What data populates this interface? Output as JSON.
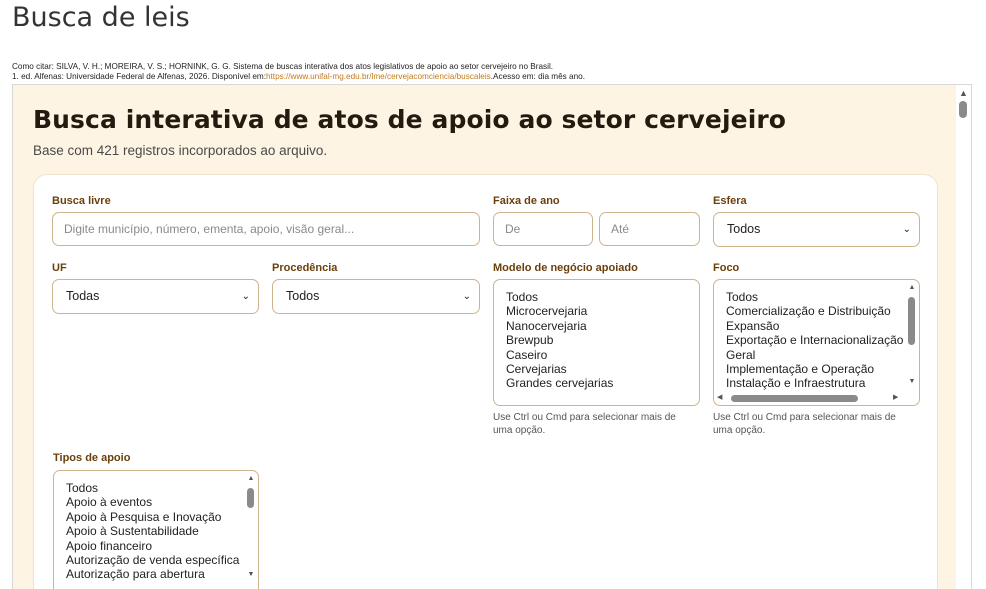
{
  "page": {
    "title": "Busca de leis",
    "citation_line1": "Como citar: SILVA, V. H.; MOREIRA, V. S.; HORNINK, G. G. Sistema de buscas interativa dos atos legislativos de apoio ao setor cervejeiro no Brasil.",
    "citation_line2_a": "1. ed. Alfenas: Universidade Federal de Alfenas, 2026. Disponível em:",
    "citation_link": "https://www.unifal-mg.edu.br/lme/cervejacomciencia/buscaleis",
    "citation_line2_b": ".Acesso em: dia mês ano."
  },
  "app": {
    "title": "Busca interativa de atos de apoio ao setor cervejeiro",
    "subtitle": "Base com 421 registros incorporados ao arquivo."
  },
  "filters": {
    "busca_livre": {
      "label": "Busca livre",
      "placeholder": "Digite município, número, ementa, apoio, visão geral..."
    },
    "faixa_ano": {
      "label": "Faixa de ano",
      "from_placeholder": "De",
      "to_placeholder": "Até"
    },
    "esfera": {
      "label": "Esfera",
      "value": "Todos"
    },
    "uf": {
      "label": "UF",
      "value": "Todas"
    },
    "procedencia": {
      "label": "Procedência",
      "value": "Todos"
    },
    "modelo": {
      "label": "Modelo de negócio apoiado",
      "options": [
        "Todos",
        "Microcervejaria",
        "Nanocervejaria",
        "Brewpub",
        "Caseiro",
        "Cervejarias",
        "Grandes cervejarias"
      ],
      "hint": "Use Ctrl ou Cmd para selecionar mais de uma opção."
    },
    "foco": {
      "label": "Foco",
      "options": [
        "Todos",
        "Comercialização e Distribuição",
        "Expansão",
        "Exportação e Internacionalização",
        "Geral",
        "Implementação e Operação",
        "Instalação e Infraestrutura"
      ],
      "hint": "Use Ctrl ou Cmd para selecionar mais de uma opção."
    },
    "tipos_apoio": {
      "label": "Tipos de apoio",
      "options": [
        "Todos",
        "Apoio à eventos",
        "Apoio à Pesquisa e Inovação",
        "Apoio à Sustentabilidade",
        "Apoio financeiro",
        "Autorização de venda específica",
        "Autorização para abertura"
      ]
    }
  },
  "icons": {
    "chevron": "chevron-down-icon",
    "scroll_up": "scroll-up-arrow-icon",
    "scroll_down": "scroll-down-arrow-icon"
  },
  "colors": {
    "accent_text": "#6b3f0c",
    "frame_bg": "#fdf4e3",
    "link": "#c47a1c",
    "input_border": "#cdb48e"
  }
}
